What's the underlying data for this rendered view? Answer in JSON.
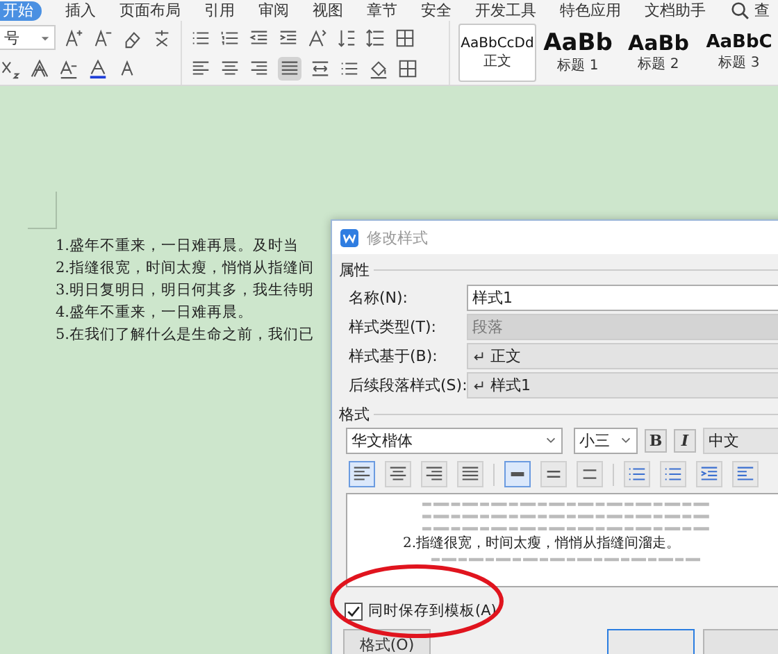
{
  "ribbon": {
    "tabs": [
      {
        "label": "开始",
        "selected": true
      },
      {
        "label": "插入",
        "selected": false
      },
      {
        "label": "页面布局",
        "selected": false
      },
      {
        "label": "引用",
        "selected": false
      },
      {
        "label": "审阅",
        "selected": false
      },
      {
        "label": "视图",
        "selected": false
      },
      {
        "label": "章节",
        "selected": false
      },
      {
        "label": "安全",
        "selected": false
      },
      {
        "label": "开发工具",
        "selected": false
      },
      {
        "label": "特色应用",
        "selected": false
      },
      {
        "label": "文档助手",
        "selected": false
      }
    ],
    "search_label": "查"
  },
  "toolbar": {
    "font_size": "号",
    "align_buttons": [
      {
        "kind": "left",
        "selected": false
      },
      {
        "kind": "center",
        "selected": false
      },
      {
        "kind": "right",
        "selected": false
      },
      {
        "kind": "justify",
        "selected": true
      },
      {
        "kind": "distribute",
        "selected": false
      }
    ],
    "styles": [
      {
        "sample": "AaBbCcDd",
        "label": "正文",
        "kind": "body",
        "selected": true
      },
      {
        "sample": "AaBb",
        "label": "标题 1",
        "kind": "h1",
        "selected": false
      },
      {
        "sample": "AaBb",
        "label": "标题 2",
        "kind": "h2",
        "selected": false
      },
      {
        "sample": "AaBbC",
        "label": "标题 3",
        "kind": "h3",
        "selected": false
      }
    ]
  },
  "document": {
    "lines": [
      "1.盛年不重来，一日难再晨。及时当",
      "2.指缝很宽，时间太瘦，悄悄从指缝间",
      "3.明日复明日，明日何其多，我生待明",
      "4.盛年不重来，一日难再晨。",
      "5.在我们了解什么是生命之前，我们已"
    ]
  },
  "dialog": {
    "title": "修改样式",
    "properties": {
      "legend": "属性",
      "rows": [
        {
          "label": "名称(N):",
          "value": "样式1",
          "kind": "text"
        },
        {
          "label": "样式类型(T):",
          "value": "段落",
          "kind": "disabled"
        },
        {
          "label": "样式基于(B):",
          "value": "正文",
          "kind": "select"
        },
        {
          "label": "后续段落样式(S):",
          "value": "样式1",
          "kind": "select"
        }
      ]
    },
    "format": {
      "legend": "格式",
      "font": "华文楷体",
      "size": "小三",
      "bold_label": "B",
      "italic_label": "I",
      "script": "中文",
      "align_buttons": [
        {
          "kind": "left",
          "selected": true
        },
        {
          "kind": "center",
          "selected": false
        },
        {
          "kind": "right",
          "selected": false
        },
        {
          "kind": "justify",
          "selected": false
        }
      ],
      "spacing_buttons": [
        {
          "kind": "single",
          "selected": true
        },
        {
          "kind": "onehalf",
          "selected": false
        },
        {
          "kind": "double",
          "selected": false
        }
      ],
      "preview_text": "2.指缝很宽，时间太瘦，悄悄从指缝间溜走。"
    },
    "save_to_template": {
      "label": "同时保存到模板(A)",
      "checked": true
    },
    "buttons": [
      {
        "label": "格式(O)",
        "kind": "plain"
      },
      {
        "kind": "default"
      },
      {
        "kind": "plain"
      }
    ]
  }
}
